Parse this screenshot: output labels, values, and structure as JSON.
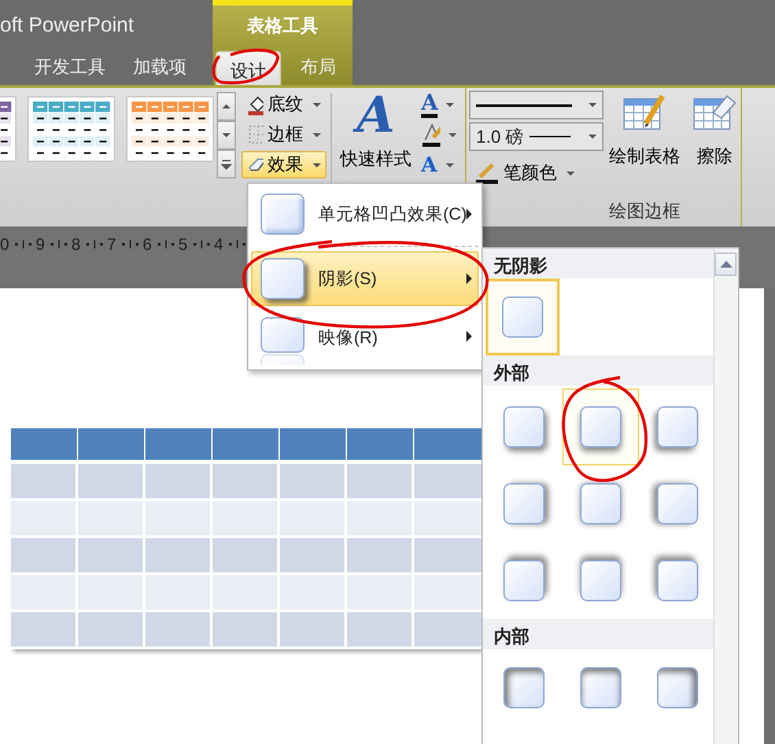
{
  "window": {
    "title": "oft PowerPoint"
  },
  "contextual_group": {
    "label": "表格工具"
  },
  "tabs": [
    {
      "label": "开发工具",
      "contextual": false,
      "selected": false
    },
    {
      "label": "加载项",
      "contextual": false,
      "selected": false
    },
    {
      "label": "设计",
      "contextual": true,
      "selected": true
    },
    {
      "label": "布局",
      "contextual": true,
      "selected": false
    }
  ],
  "ribbon": {
    "table_styles": [
      {
        "color": "#8064a2"
      },
      {
        "color": "#4bacc6"
      },
      {
        "color": "#f79646"
      }
    ],
    "table_buttons": [
      {
        "label": "底纹",
        "kind": "shading",
        "active": false
      },
      {
        "label": "边框",
        "kind": "borders",
        "active": false
      },
      {
        "label": "效果",
        "kind": "effects",
        "active": true
      }
    ],
    "quick_styles": {
      "glyph": "A",
      "label": "快速样式"
    },
    "wordart_buttons": [
      {
        "kind": "fill",
        "glyph": "A"
      },
      {
        "kind": "outline"
      },
      {
        "kind": "effects",
        "glyph": "A"
      }
    ],
    "draw_borders": {
      "label": "绘图边框",
      "pen_weight": "1.0 磅",
      "pen_color": "笔颜色",
      "buttons": [
        {
          "label": "绘制表格",
          "kind": "draw"
        },
        {
          "label": "擦除",
          "kind": "erase"
        }
      ]
    }
  },
  "ruler": {
    "labels": [
      "0",
      "9",
      "8",
      "7",
      "6",
      "5",
      "4"
    ]
  },
  "slide_table": {
    "rows": [
      {
        "kind": "header"
      },
      {
        "kind": "band"
      },
      {
        "kind": "plain"
      },
      {
        "kind": "band"
      },
      {
        "kind": "plain"
      },
      {
        "kind": "band"
      }
    ]
  },
  "effects_menu": {
    "items": [
      {
        "label": "单元格凹凸效果(C)",
        "kind": "bevel",
        "selected": false
      },
      {
        "label": "阴影(S)",
        "kind": "shadow",
        "selected": true
      },
      {
        "label": "映像(R)",
        "kind": "reflection",
        "selected": false
      }
    ]
  },
  "shadow_gallery": {
    "sections": [
      {
        "title": "无阴影",
        "kind": "none",
        "items": [
          {
            "selected": true,
            "hovered": false
          }
        ]
      },
      {
        "title": "外部",
        "kind": "outer",
        "items": [
          {
            "selected": false,
            "hovered": false
          },
          {
            "selected": false,
            "hovered": true
          },
          {
            "selected": false,
            "hovered": false
          },
          {
            "selected": false,
            "hovered": false
          },
          {
            "selected": false,
            "hovered": false
          },
          {
            "selected": false,
            "hovered": false
          },
          {
            "selected": false,
            "hovered": false
          },
          {
            "selected": false,
            "hovered": false
          },
          {
            "selected": false,
            "hovered": false
          }
        ]
      },
      {
        "title": "内部",
        "kind": "inner",
        "items": [
          {
            "selected": false,
            "hovered": false
          },
          {
            "selected": false,
            "hovered": false
          },
          {
            "selected": false,
            "hovered": false
          }
        ]
      }
    ]
  },
  "markup": [
    {
      "kind": "tab-circle"
    },
    {
      "kind": "menu-circle"
    },
    {
      "kind": "gallery-circle"
    }
  ]
}
